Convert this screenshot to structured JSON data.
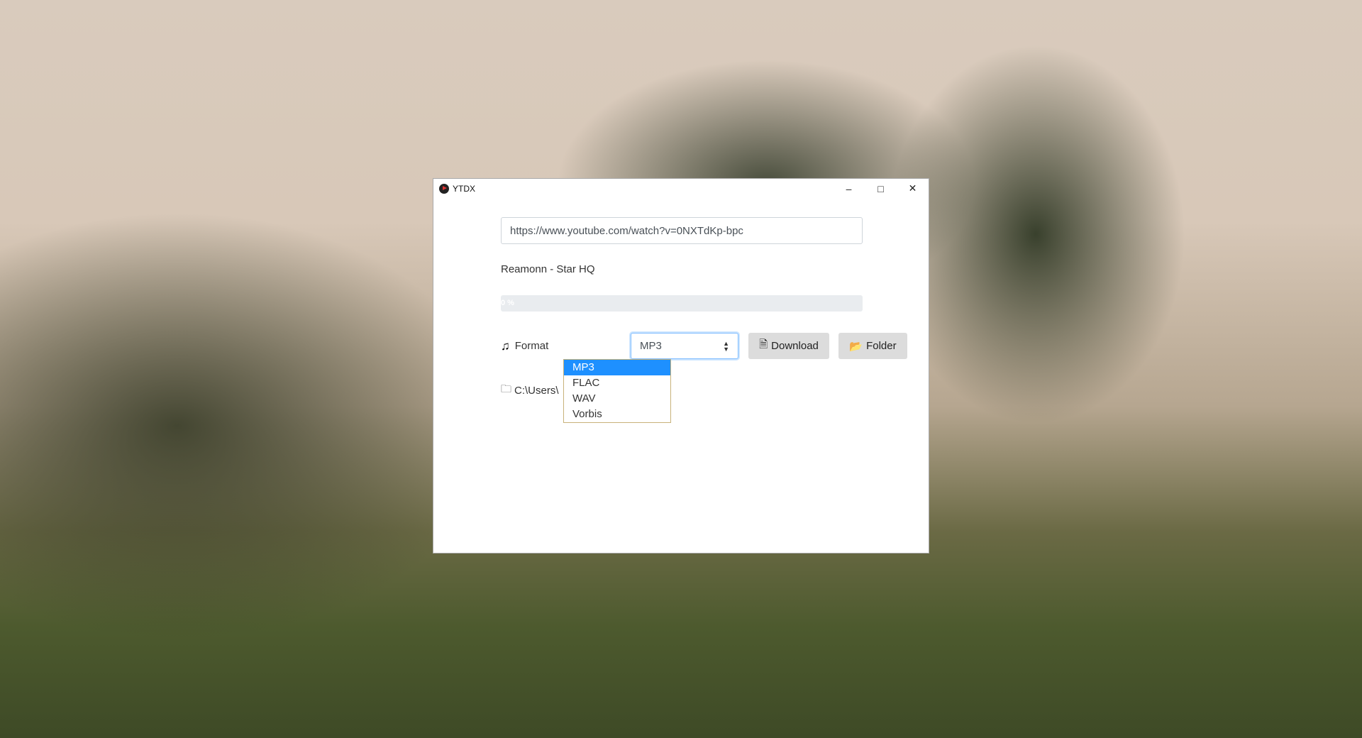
{
  "window": {
    "title": "YTDX",
    "controls": [
      "minimize",
      "maximize",
      "close"
    ]
  },
  "url_input": {
    "value": "https://www.youtube.com/watch?v=0NXTdKp-bpc"
  },
  "video_title": "Reamonn - Star HQ",
  "progress": {
    "percent": 0,
    "label": "0 %"
  },
  "format": {
    "label": "Format",
    "selected": "MP3",
    "options": [
      "MP3",
      "FLAC",
      "WAV",
      "Vorbis"
    ]
  },
  "buttons": {
    "download": "Download",
    "folder": "Folder"
  },
  "path": {
    "text": "C:\\Users\\"
  },
  "colors": {
    "highlight": "#1e90ff",
    "button_bg": "#dcdcdc",
    "progress_bg": "#e9ecef"
  }
}
